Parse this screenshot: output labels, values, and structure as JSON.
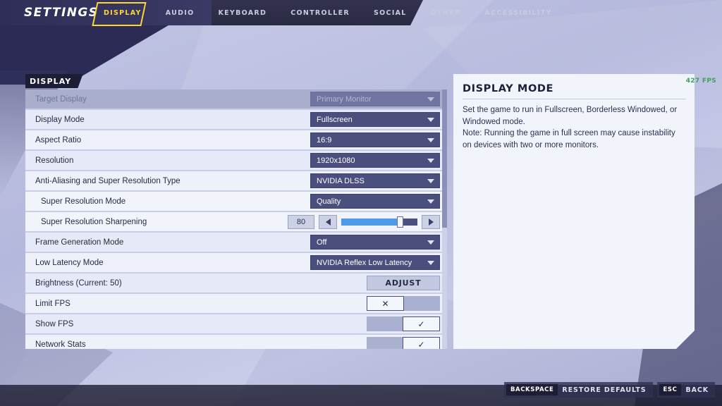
{
  "header": {
    "title": "SETTINGS",
    "tabs": [
      {
        "label": "DISPLAY",
        "active": true
      },
      {
        "label": "AUDIO",
        "active": false
      },
      {
        "label": "KEYBOARD",
        "active": false
      },
      {
        "label": "CONTROLLER",
        "active": false
      },
      {
        "label": "SOCIAL",
        "active": false
      },
      {
        "label": "OTHER",
        "active": false
      },
      {
        "label": "ACCESSIBILITY",
        "active": false
      }
    ]
  },
  "panel": {
    "tag": "DISPLAY",
    "rows": [
      {
        "label": "Target Display",
        "type": "dropdown",
        "value": "Primary Monitor",
        "disabled": true,
        "indent": false
      },
      {
        "label": "Display Mode",
        "type": "dropdown",
        "value": "Fullscreen",
        "disabled": false,
        "indent": false
      },
      {
        "label": "Aspect Ratio",
        "type": "dropdown",
        "value": "16:9",
        "disabled": false,
        "indent": false
      },
      {
        "label": "Resolution",
        "type": "dropdown",
        "value": "1920x1080",
        "disabled": false,
        "indent": false
      },
      {
        "label": "Anti-Aliasing and Super Resolution Type",
        "type": "dropdown",
        "value": "NVIDIA DLSS",
        "disabled": false,
        "indent": false
      },
      {
        "label": "Super Resolution Mode",
        "type": "dropdown",
        "value": "Quality",
        "disabled": false,
        "indent": true
      },
      {
        "label": "Super Resolution Sharpening",
        "type": "slider",
        "value": "80",
        "percent": 80,
        "disabled": false,
        "indent": true
      },
      {
        "label": "Frame Generation Mode",
        "type": "dropdown",
        "value": "Off",
        "disabled": false,
        "indent": false
      },
      {
        "label": "Low Latency Mode",
        "type": "dropdown",
        "value": "NVIDIA Reflex Low Latency",
        "disabled": false,
        "indent": false
      },
      {
        "label": "Brightness (Current: 50)",
        "type": "button",
        "value": "ADJUST",
        "disabled": false,
        "indent": false
      },
      {
        "label": "Limit FPS",
        "type": "toggle",
        "value": "off",
        "disabled": false,
        "indent": false
      },
      {
        "label": "Show FPS",
        "type": "toggle",
        "value": "on",
        "disabled": false,
        "indent": false
      },
      {
        "label": "Network Stats",
        "type": "toggle",
        "value": "on",
        "disabled": false,
        "indent": false
      }
    ],
    "toggle_on_glyph": "✓",
    "toggle_off_glyph": "✕"
  },
  "info": {
    "title": "DISPLAY MODE",
    "paragraphs": [
      "Set the game to run in Fullscreen, Borderless Windowed, or Windowed mode.",
      "Note: Running the game in full screen may cause instability on devices with two or more monitors."
    ]
  },
  "hud": {
    "fps": "427 FPS"
  },
  "footer": {
    "buttons": [
      {
        "key": "BACKSPACE",
        "label": "RESTORE DEFAULTS"
      },
      {
        "key": "ESC",
        "label": "BACK"
      }
    ]
  },
  "colors": {
    "accent": "#ffd633",
    "dropdown": "#4a4f7e",
    "slider_fill": "#4d9ae8",
    "fps": "#3ea05a"
  }
}
